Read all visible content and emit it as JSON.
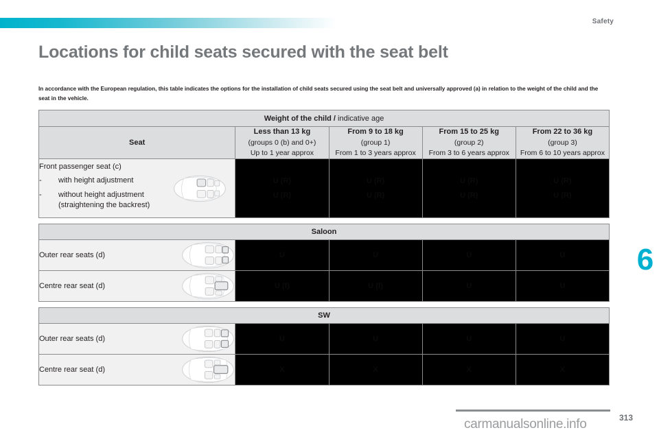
{
  "header": {
    "chapter_label": "Safety",
    "accent_color": "#00b0d0"
  },
  "title": "Locations for child seats secured with the seat belt",
  "intro": "In accordance with the European regulation, this table indicates the options for the installation of child seats secured using the seat belt and universally approved (a) in relation to the weight of the child and the seat in the vehicle.",
  "table": {
    "top_header": {
      "bold_part": "Weight of the child /",
      "normal_part": " indicative age"
    },
    "seat_column_header": "Seat",
    "weight_columns": [
      {
        "weight": "Less than 13 kg",
        "group": "(groups 0 (b) and 0+)",
        "age": "Up to 1 year approx"
      },
      {
        "weight": "From 9 to 18 kg",
        "group": "(group 1)",
        "age": "From 1 to 3 years approx"
      },
      {
        "weight": "From 15 to 25 kg",
        "group": "(group 2)",
        "age": "From 3 to 6 years approx"
      },
      {
        "weight": "From 22 to 36 kg",
        "group": "(group 3)",
        "age": "From 6 to 10 years approx"
      }
    ],
    "front_row": {
      "title": "Front passenger seat (c)",
      "dash": "-",
      "bullet_1": "with height adjustment",
      "bullet_2_line1": "without height adjustment",
      "bullet_2_line2": "(straightening the backrest)",
      "values_line1": [
        "U (R)",
        "U (R)",
        "U (R)",
        "U (R)"
      ],
      "values_line2": [
        "U (R)",
        "U (R)",
        "U (R)",
        "U (R)"
      ]
    },
    "sections": [
      {
        "band_label": "Saloon",
        "rows": [
          {
            "label": "Outer rear seats (d)",
            "values": [
              "U",
              "U",
              "U",
              "U"
            ]
          },
          {
            "label": "Centre rear seat (d)",
            "values": [
              "U (f)",
              "U (f)",
              "U",
              "U"
            ]
          }
        ]
      },
      {
        "band_label": "SW",
        "rows": [
          {
            "label": "Outer rear seats (d)",
            "values": [
              "U",
              "U",
              "U",
              "U"
            ]
          },
          {
            "label": "Centre rear seat (d)",
            "values": [
              "X",
              "X",
              "X",
              "X"
            ]
          }
        ]
      }
    ]
  },
  "side_tab": {
    "number": "6"
  },
  "footer": {
    "page_number": "313",
    "watermark": "carmanualsonline.info"
  }
}
